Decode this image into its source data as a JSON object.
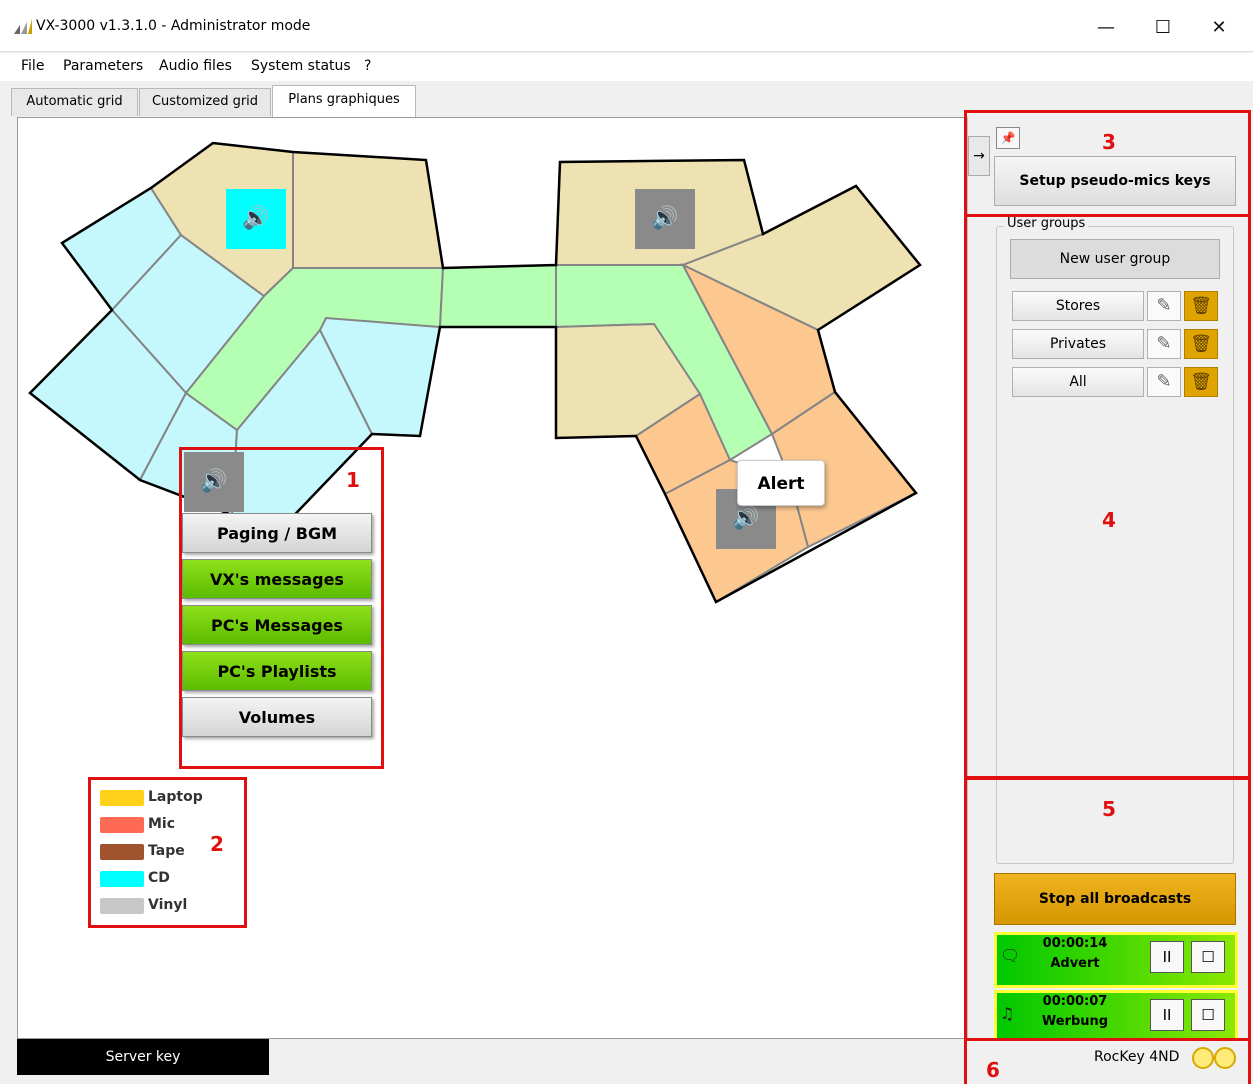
{
  "window": {
    "title": "VX-3000 v1.3.1.0 - Administrator mode",
    "minimize": "—",
    "maximize": "☐",
    "close": "✕"
  },
  "menu": [
    "File",
    "Parameters",
    "Audio files",
    "System status",
    "?"
  ],
  "tabs": [
    "Automatic grid",
    "Customized grid",
    "Plans graphiques"
  ],
  "active_tab": "Plans graphiques",
  "map": {
    "speaker_glyph": "🔊",
    "alert_label": "Alert"
  },
  "context_menu": {
    "items": [
      "Paging / BGM",
      "VX's messages",
      "PC's Messages",
      "PC's Playlists",
      "Volumes"
    ],
    "green_items": [
      "VX's messages",
      "PC's Messages",
      "PC's Playlists"
    ]
  },
  "legend": [
    {
      "label": "Laptop",
      "color": "#ffd21a"
    },
    {
      "label": "Mic",
      "color": "#ff6a55"
    },
    {
      "label": "Tape",
      "color": "#a0522d"
    },
    {
      "label": "CD",
      "color": "#00ffff"
    },
    {
      "label": "Vinyl",
      "color": "#c8c8c8"
    }
  ],
  "annotations": {
    "n1": "1",
    "n2": "2",
    "n3": "3",
    "n4": "4",
    "n5": "5",
    "n6": "6"
  },
  "panel": {
    "setup_button": "Setup pseudo-mics keys",
    "user_groups_title": "User groups",
    "new_group_button": "New user group",
    "groups": [
      "Stores",
      "Privates",
      "All"
    ],
    "stop_all": "Stop all broadcasts",
    "broadcasts": [
      {
        "time": "00:00:14",
        "name": "Advert",
        "icon": "message-icon"
      },
      {
        "time": "00:00:07",
        "name": "Werbung",
        "icon": "music-note-icon"
      }
    ],
    "pause_glyph": "II",
    "stop_glyph": "☐"
  },
  "status": {
    "server_key": "Server key",
    "dongle": "RocKey 4ND"
  },
  "colors": {
    "cyan_zone": "#c4f8fc",
    "tan_zone": "#eee2b2",
    "green_zone": "#b4ffb4",
    "orange_zone": "#fcc890",
    "speaker_active": "#00ffff",
    "speaker_idle": "#8a8a8a",
    "highlight": "#e01010",
    "broadcast_border": "#ffff33"
  }
}
